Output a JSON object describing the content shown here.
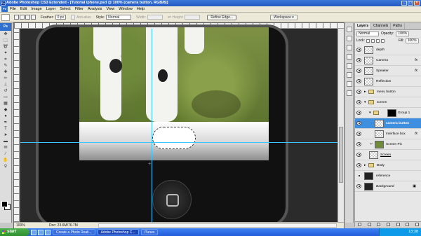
{
  "window": {
    "title": "Adobe Photoshop CS3 Extended - [Tutorial iphone.psd @ 100% (camera button, RGB/8)]"
  },
  "menubar": {
    "items": [
      "File",
      "Edit",
      "Image",
      "Layer",
      "Select",
      "Filter",
      "Analysis",
      "View",
      "Window",
      "Help"
    ]
  },
  "options": {
    "feather_label": "Feather:",
    "feather_value": "0 px",
    "antialias_label": "Anti-alias",
    "style_label": "Style:",
    "style_value": "Normal",
    "width_label": "Width:",
    "height_label": "Height:",
    "refine_label": "Refine Edge...",
    "workspace_label": "Workspace"
  },
  "status": {
    "zoom": "100%",
    "doc": "Doc: 23.6M/76.7M"
  },
  "layers_panel": {
    "tabs": [
      "Layers",
      "Channels",
      "Paths"
    ],
    "blend_mode": "Normal",
    "opacity_label": "Opacity:",
    "opacity_value": "100%",
    "lock_label": "Lock:",
    "fill_label": "Fill:",
    "fill_value": "100%",
    "layers": [
      {
        "name": "depth",
        "fx": ""
      },
      {
        "name": "Camera",
        "fx": "fx"
      },
      {
        "name": "Speaker",
        "fx": "fx"
      },
      {
        "name": "Reflection",
        "fx": ""
      },
      {
        "name": "menu button",
        "fx": ""
      },
      {
        "name": "screen",
        "fx": ""
      },
      {
        "name": "Group 1",
        "fx": ""
      },
      {
        "name": "camera button",
        "fx": ""
      },
      {
        "name": "Interface box",
        "fx": "fx"
      },
      {
        "name": "Screen Pic",
        "fx": ""
      },
      {
        "name": "Screen",
        "fx": ""
      },
      {
        "name": "Body",
        "fx": ""
      },
      {
        "name": "reference",
        "fx": ""
      },
      {
        "name": "Background",
        "fx": ""
      }
    ]
  },
  "taskbar": {
    "start": "start",
    "tasks": [
      "Create a Photo Reali...",
      "Adobe Photoshop C...",
      "iTunes"
    ],
    "clock": "13:38"
  }
}
